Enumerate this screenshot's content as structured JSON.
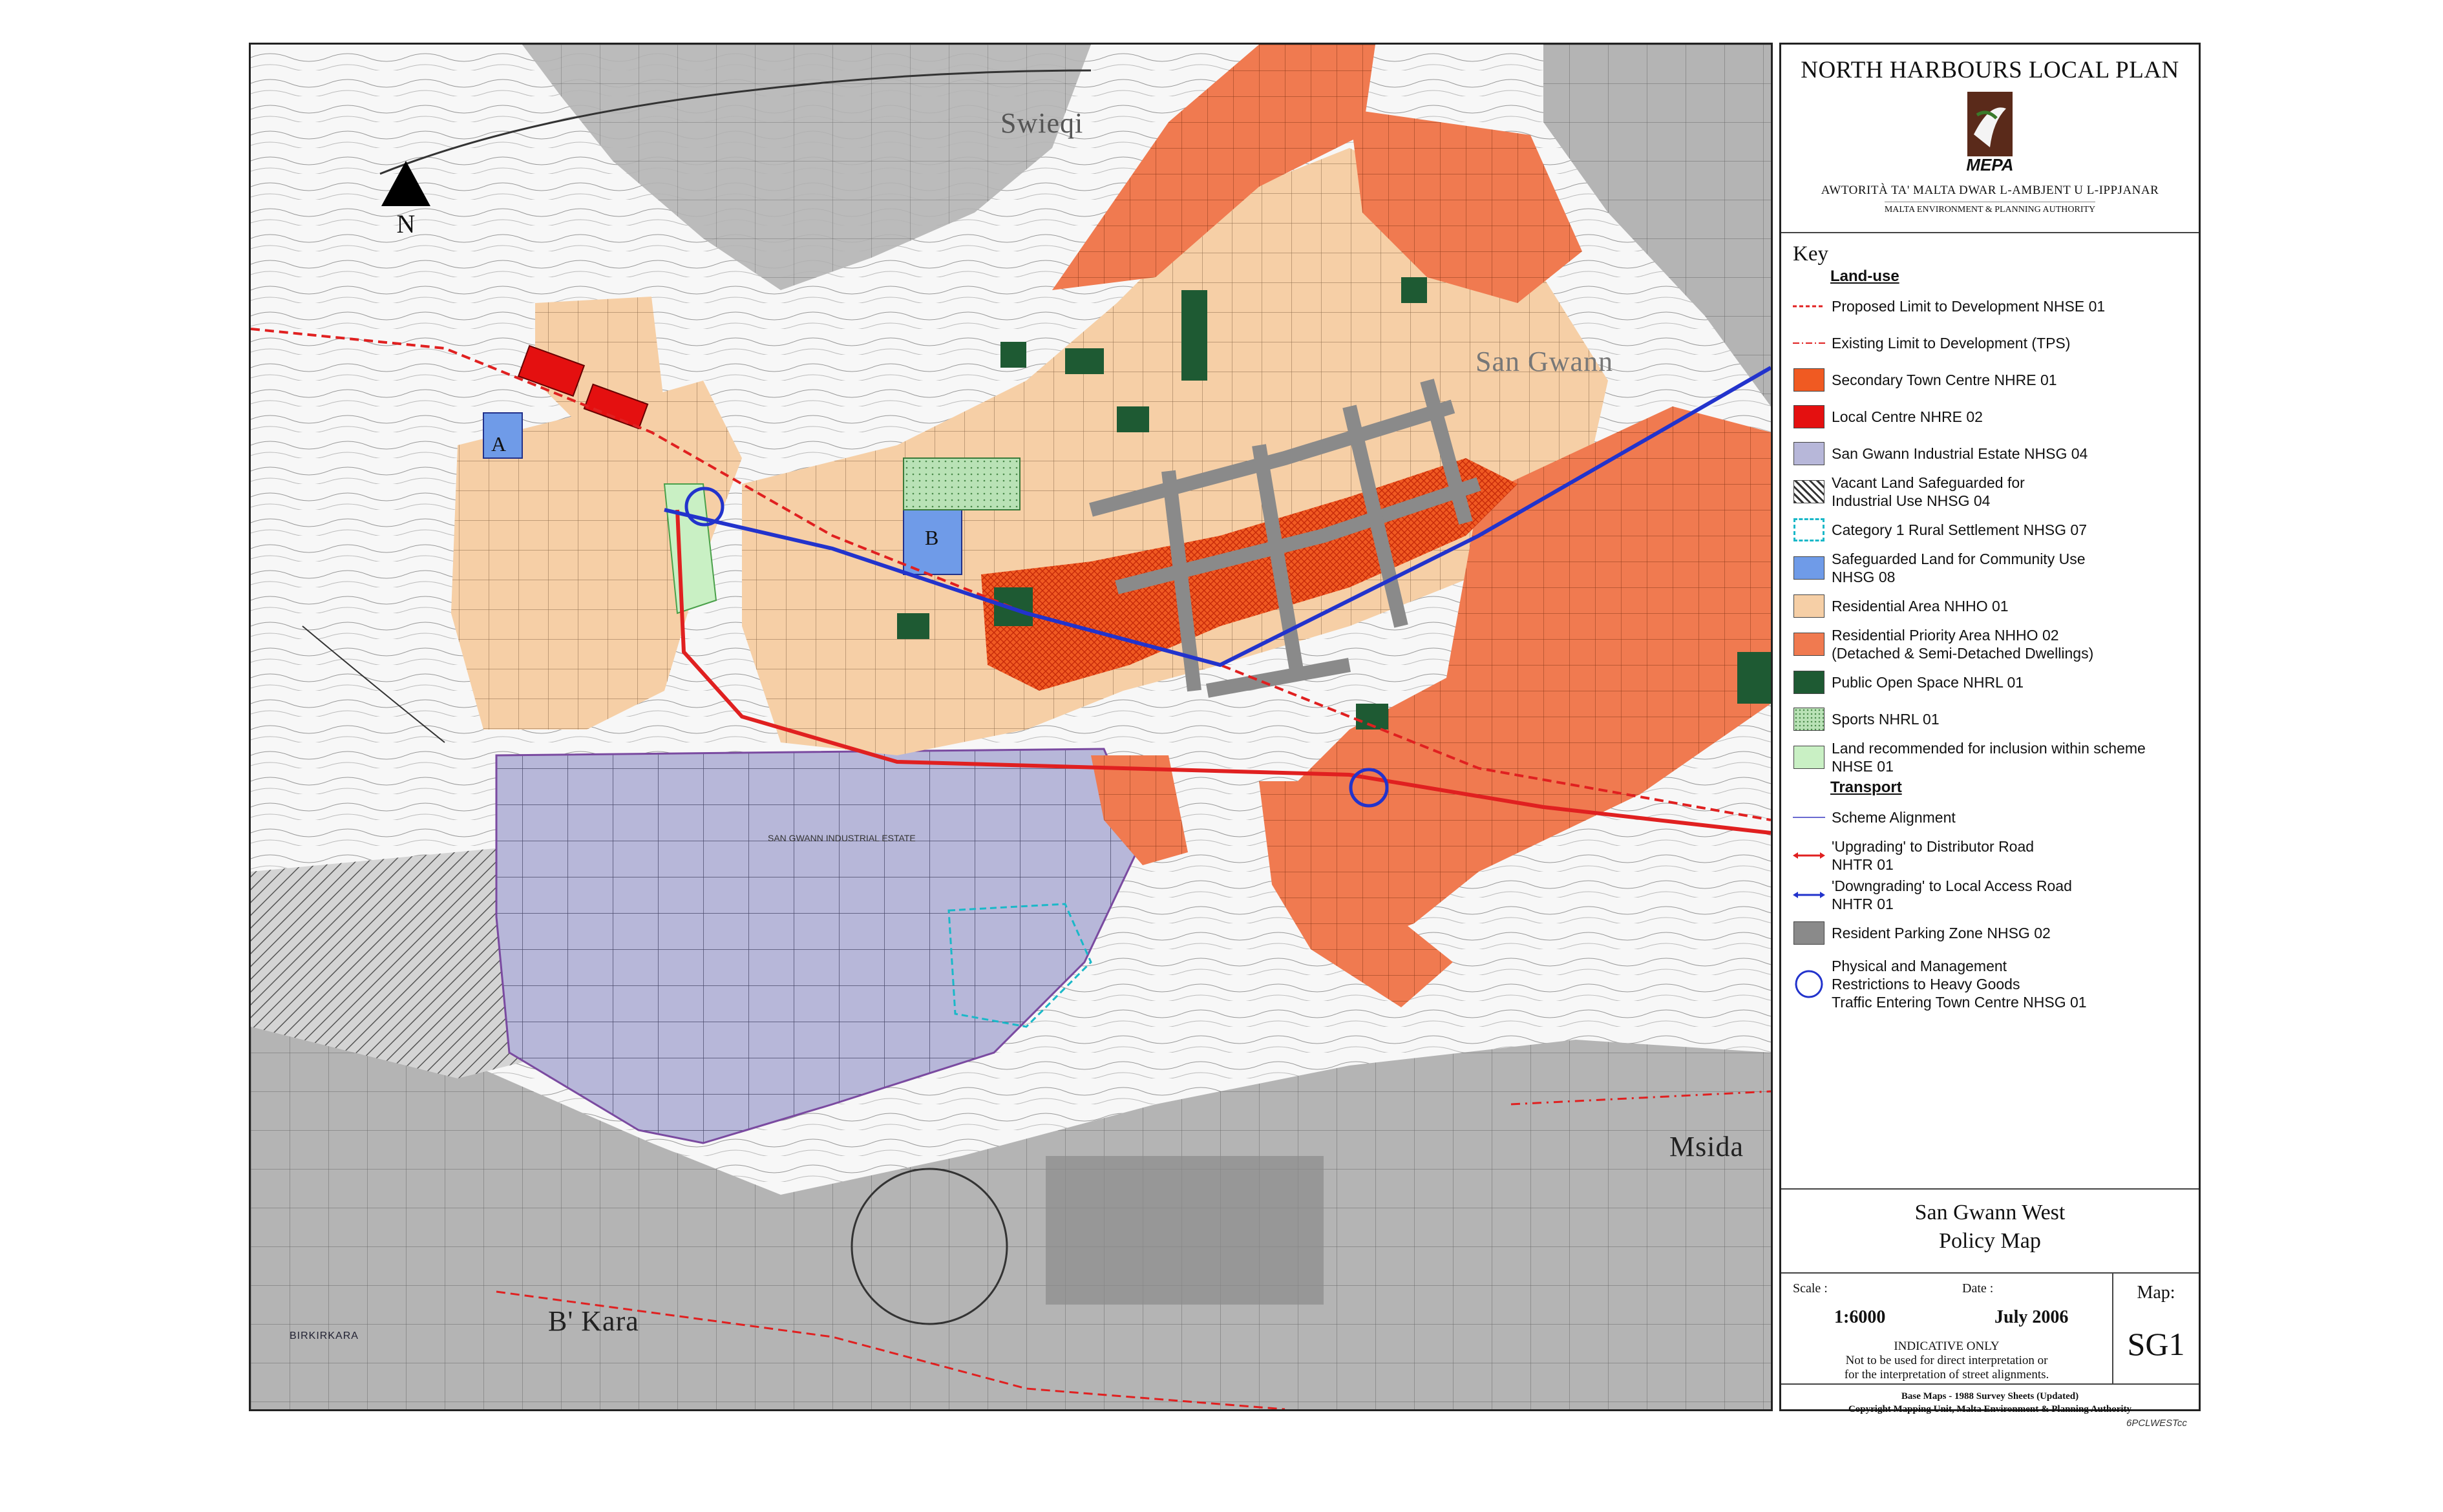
{
  "map": {
    "place_labels": {
      "swieqi": "Swieqi",
      "san_gwann": "San Gwann",
      "bkara": "B' Kara",
      "msida": "Msida",
      "site_a": "A",
      "site_b": "B",
      "industrial_estate": "SAN GWANN INDUSTRIAL ESTATE",
      "birkirkara_street": "BIRKIRKARA"
    },
    "north": "N",
    "colors": {
      "residential": "#f6cfa6",
      "residential_priority": "#f07a50",
      "town_centre": "#ef4a1a",
      "local_centre": "#e41010",
      "industrial": "#b7b7d9",
      "community": "#6f9be8",
      "open_space": "#1e5a33",
      "sports": "#b9e2b6",
      "scheme_land": "#c9f0c4",
      "parking": "#8a8a8a",
      "built_grey": "#b4b4b4",
      "dev_limit": "#e02020",
      "local_access": "#2233cc"
    }
  },
  "sidebar": {
    "plan_title": "NORTH HARBOURS LOCAL PLAN",
    "logo_text": "MEPA",
    "authority_mt": "AWTORITÀ TA' MALTA DWAR L-AMBJENT U L-IPPJANAR",
    "authority_en": "MALTA ENVIRONMENT & PLANNING AUTHORITY",
    "key_title": "Key",
    "landuse_heading": "Land-use",
    "transport_heading": "Transport",
    "legend": {
      "proposed_limit": "Proposed Limit to Development NHSE 01",
      "existing_limit": "Existing Limit to Development (TPS)",
      "secondary_town_centre": "Secondary Town Centre NHRE 01",
      "local_centre": "Local Centre NHRE 02",
      "industrial_estate": "San Gwann Industrial Estate NHSG 04",
      "vacant_land_1": "Vacant Land Safeguarded for",
      "vacant_land_2": "Industrial Use NHSG 04",
      "rural_settlement": "Category 1 Rural Settlement NHSG 07",
      "community_use_1": "Safeguarded Land for Community Use",
      "community_use_2": "NHSG 08",
      "residential": "Residential Area NHHO 01",
      "residential_priority_1": "Residential Priority Area NHHO 02",
      "residential_priority_2": "(Detached & Semi-Detached Dwellings)",
      "open_space": "Public Open Space NHRL 01",
      "sports": "Sports NHRL 01",
      "scheme_land_1": "Land recommended for inclusion within scheme",
      "scheme_land_2": "NHSE 01",
      "scheme_alignment": "Scheme Alignment",
      "upgrading_1": "'Upgrading' to Distributor Road",
      "upgrading_2": "NHTR 01",
      "downgrading_1": "'Downgrading' to Local Access Road",
      "downgrading_2": "NHTR 01",
      "parking_zone": "Resident Parking Zone NHSG 02",
      "restrictions_1": "Physical and Management",
      "restrictions_2": "Restrictions to Heavy Goods",
      "restrictions_3": "Traffic Entering Town Centre NHSG 01"
    },
    "map_title_1": "San Gwann West",
    "map_title_2": "Policy Map",
    "scale_label": "Scale :",
    "scale_value": "1:6000",
    "date_label": "Date :",
    "date_value": "July 2006",
    "indicative_1": "INDICATIVE ONLY",
    "indicative_2": "Not to be used for direct interpretation or",
    "indicative_3": "for the interpretation of street alignments.",
    "map_label": "Map:",
    "map_code": "SG1",
    "credits_1": "Base Maps - 1988 Survey Sheets (Updated)",
    "credits_2": "Copyright Mapping Unit, Malta Environment & Planning Authority",
    "file_ref": "6PCLWESTcc"
  }
}
